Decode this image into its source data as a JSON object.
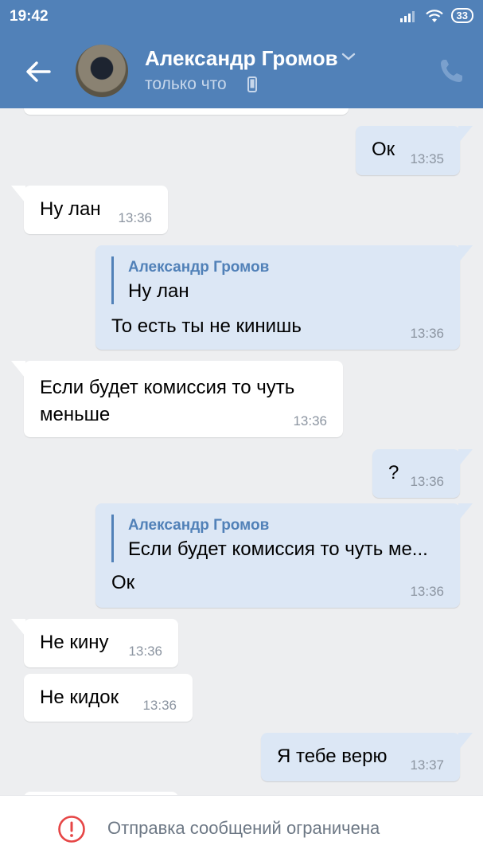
{
  "status_bar": {
    "time": "19:42",
    "battery": "33",
    "icons": [
      "signal-icon",
      "wifi-icon",
      "battery-icon"
    ]
  },
  "header": {
    "contact_name": "Александр Громов",
    "contact_status": "только что",
    "icons": [
      "back-arrow-icon",
      "chevron-down-icon",
      "mobile-device-icon",
      "phone-icon"
    ]
  },
  "messages": [
    {
      "dir": "out",
      "text": "Ок",
      "time": "13:35"
    },
    {
      "dir": "in",
      "text": "Ну лан",
      "time": "13:36"
    },
    {
      "dir": "out",
      "quote_author": "Александр Громов",
      "quote_text": "Ну лан",
      "text": "То есть ты не кинишь",
      "time": "13:36"
    },
    {
      "dir": "in",
      "text_line1": "Если будет комиссия то чуть",
      "text_line2": "меньше",
      "time": "13:36"
    },
    {
      "dir": "out",
      "text": "?",
      "time": "13:36"
    },
    {
      "dir": "out",
      "quote_author": "Александр Громов",
      "quote_text": "Если будет комиссия то чуть ме...",
      "text": "Ок",
      "time": "13:36"
    },
    {
      "dir": "in",
      "text": "Не кину",
      "time": "13:36"
    },
    {
      "dir": "in",
      "text": "Не кидок",
      "time": "13:36"
    },
    {
      "dir": "out",
      "text": "Я тебе верю",
      "time": "13:37"
    }
  ],
  "footer": {
    "restriction_text": "Отправка сообщений ограничена"
  },
  "colors": {
    "header_bg": "#5181b8",
    "chat_bg": "#edeef0",
    "incoming_bubble": "#ffffff",
    "outgoing_bubble": "#dce7f5",
    "quote_accent": "#5181b8",
    "alert_red": "#e64646"
  }
}
